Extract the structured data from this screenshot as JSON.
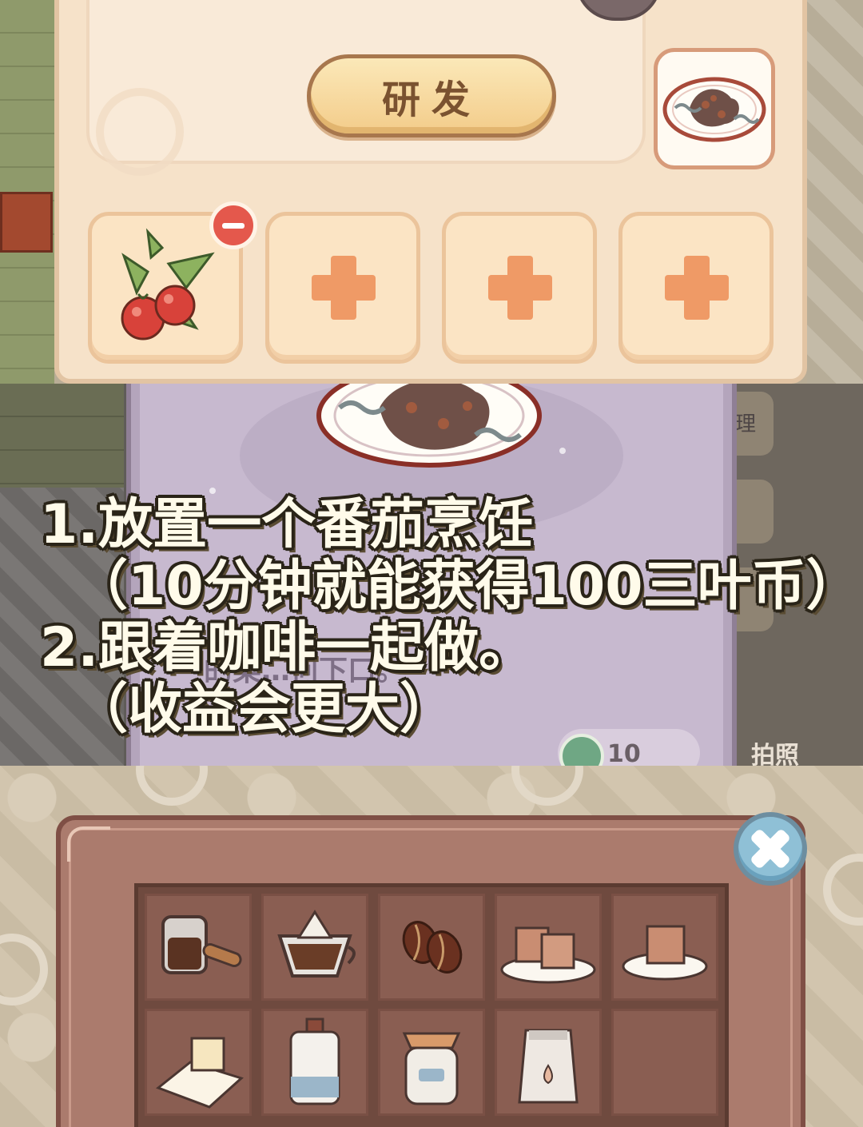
{
  "research_panel": {
    "research_button_label": "研发",
    "result_dish_icon": "dish-icon",
    "ingredient_slots": [
      {
        "state": "filled",
        "icon": "tomato-icon",
        "removable": true
      },
      {
        "state": "empty",
        "icon": "plus-icon"
      },
      {
        "state": "empty",
        "icon": "plus-icon"
      },
      {
        "state": "empty",
        "icon": "plus-icon"
      }
    ]
  },
  "recipe_panel": {
    "dish_icon": "dish-icon",
    "faded_description": "的菜…何下口。",
    "cost_icon": "clover-coin-icon",
    "cost_value": "10",
    "side_tab_text": "理",
    "below_text": "拍照"
  },
  "caption": {
    "line1": "1.放置一个番茄烹饪",
    "line2": "（10分钟就能获得100三叶币）",
    "line3": "2.跟着咖啡一起做。",
    "line4": "（收益会更大）"
  },
  "inventory": {
    "close_icon": "close-icon",
    "items": [
      {
        "name": "coffee-pot-icon"
      },
      {
        "name": "pour-over-coffee-icon"
      },
      {
        "name": "coffee-beans-icon"
      },
      {
        "name": "two-sugar-cubes-icon"
      },
      {
        "name": "sugar-cube-plate-icon"
      },
      {
        "name": "butter-icon"
      },
      {
        "name": "milk-bottle-icon"
      },
      {
        "name": "jam-jar-icon"
      },
      {
        "name": "flour-bag-icon"
      },
      {
        "name": "empty-slot"
      }
    ]
  },
  "colors": {
    "panel_cream": "#f6e2c9",
    "button_gold": "#f3cc8a",
    "plus_orange": "#ef9a66",
    "remove_red": "#e4584c",
    "caption_fill": "#fffbea",
    "inventory_brown": "#ab7b6d",
    "close_blue": "#8fc0d6"
  }
}
